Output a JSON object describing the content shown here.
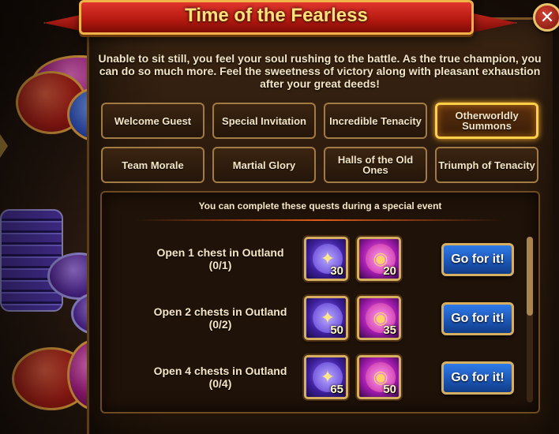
{
  "window": {
    "title": "Time of the Fearless",
    "close_glyph": "✕",
    "description": "Unable to sit still, you feel your soul rushing to the battle. As the true champion, you can do so much more. Feel the sweetness of victory along with pleasant exhaustion after your great deeds!"
  },
  "tabs": [
    {
      "label": "Welcome Guest",
      "active": false
    },
    {
      "label": "Special Invitation",
      "active": false
    },
    {
      "label": "Incredible Tenacity",
      "active": false
    },
    {
      "label": "Otherworldly Summons",
      "active": true
    },
    {
      "label": "Team Morale",
      "active": false
    },
    {
      "label": "Martial Glory",
      "active": false
    },
    {
      "label": "Halls of the Old Ones",
      "active": false
    },
    {
      "label": "Triumph of Tenacity",
      "active": false
    }
  ],
  "quests": {
    "header": "You can complete these quests during a special event",
    "items": [
      {
        "title": "Open 1 chest in Outland",
        "progress": "(0/1)",
        "rewards": [
          {
            "icon": "sky-stone-icon",
            "count": "30"
          },
          {
            "icon": "eye-emblem-icon",
            "count": "20"
          }
        ],
        "button": "Go for it!"
      },
      {
        "title": "Open 2 chests in Outland",
        "progress": "(0/2)",
        "rewards": [
          {
            "icon": "sky-stone-icon",
            "count": "50"
          },
          {
            "icon": "eye-emblem-icon",
            "count": "35"
          }
        ],
        "button": "Go for it!"
      },
      {
        "title": "Open 4 chests in Outland",
        "progress": "(0/4)",
        "rewards": [
          {
            "icon": "sky-stone-icon",
            "count": "65"
          },
          {
            "icon": "eye-emblem-icon",
            "count": "50"
          }
        ],
        "button": "Go for it!"
      }
    ]
  },
  "colors": {
    "banner": "#b3180f",
    "accent_gold": "#ffcf4a",
    "button_blue": "#1a54b4"
  }
}
